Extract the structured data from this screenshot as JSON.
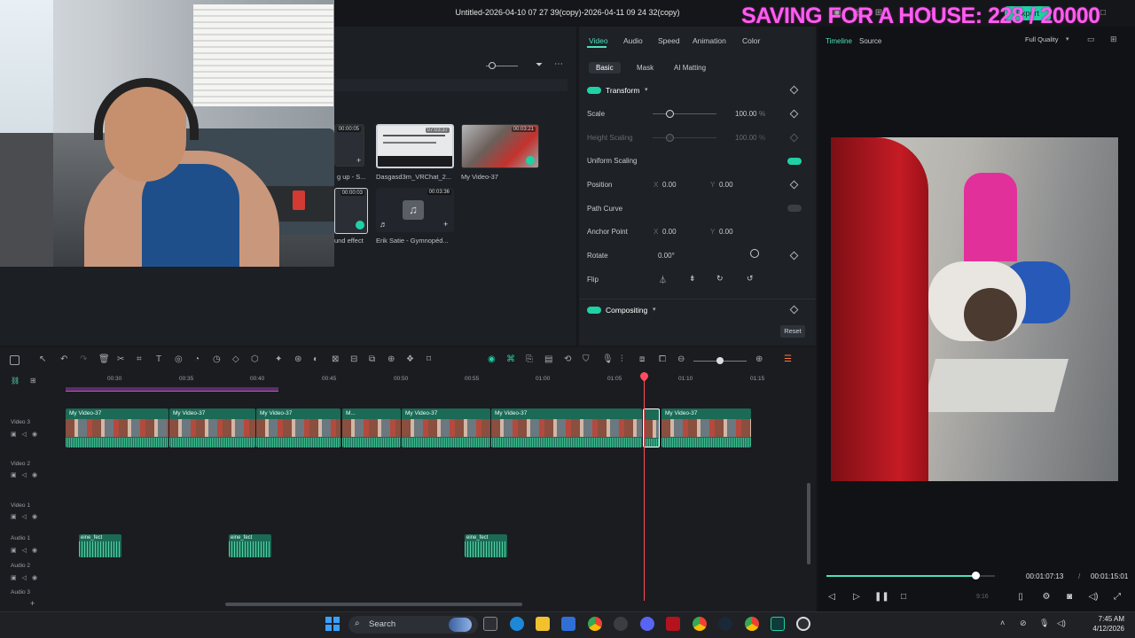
{
  "window": {
    "title": "Untitled-2026-04-10 07 27 39(copy)-2026-04-11 09 24 32(copy)",
    "export_label": "Export"
  },
  "stream_overlay": {
    "text": "SAVING FOR A HOUSE: 228 / 20000",
    "color": "#ff5cf0"
  },
  "media": {
    "items": [
      {
        "label": "g up - S...",
        "duration": "00:00:05"
      },
      {
        "label": "Dasgasd3m_VRChat_2...",
        "duration": "07:03:37"
      },
      {
        "label": "My Video-37",
        "duration": "00:03:21"
      },
      {
        "label": "und effect",
        "duration": "00:00:03"
      },
      {
        "label": "Erik Satie - Gymnopéd...",
        "duration": "00:03:36"
      }
    ]
  },
  "properties": {
    "tabs": [
      "Video",
      "Audio",
      "Speed",
      "Animation",
      "Color"
    ],
    "active_tab": "Video",
    "subtabs": [
      "Basic",
      "Mask",
      "AI Matting"
    ],
    "sections": {
      "transform": "Transform",
      "compositing": "Compositing"
    },
    "rows": {
      "scale_label": "Scale",
      "scale_value": "100.00",
      "height_scaling_label": "Height Scaling",
      "height_scaling_value": "100.00",
      "uniform_scaling_label": "Uniform Scaling",
      "position_label": "Position",
      "position_x": "0.00",
      "position_y": "0.00",
      "path_curve_label": "Path Curve",
      "anchor_label": "Anchor Point",
      "anchor_x": "0.00",
      "anchor_y": "0.00",
      "rotate_label": "Rotate",
      "rotate_value": "0.00°",
      "flip_label": "Flip",
      "x_label": "X",
      "y_label": "Y",
      "pct": "%"
    },
    "reset_label": "Reset"
  },
  "preview": {
    "tabs": {
      "timeline": "Timeline",
      "source": "Source"
    },
    "quality": "Full Quality",
    "current_time": "00:01:07:13",
    "separator": "/",
    "total_time": "00:01:15:01",
    "aspect": "9:16",
    "progress": 0.89
  },
  "timeline": {
    "ticks": [
      "00:30",
      "00:35",
      "00:40",
      "00:45",
      "00:50",
      "00:55",
      "01:00",
      "01:05",
      "01:10",
      "01:15"
    ],
    "tracks": [
      "Video 3",
      "Video 2",
      "Video 1",
      "Audio 1",
      "Audio 2",
      "Audio 3"
    ],
    "clip_name": "My Video-37",
    "clip_short": "M...",
    "audio_clip_name": "eine_fect"
  },
  "taskbar": {
    "search_placeholder": "Search",
    "time": "7:45 AM",
    "date": "4/12/2026"
  },
  "colors": {
    "accent": "#1fd1a5",
    "playhead": "#ff4d5e"
  }
}
